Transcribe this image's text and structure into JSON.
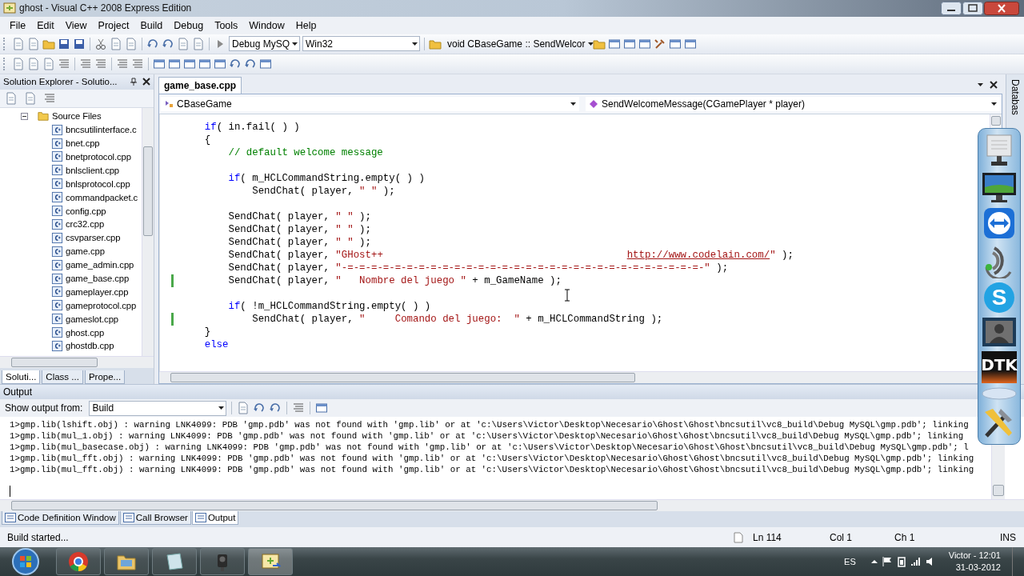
{
  "window": {
    "title": "ghost - Visual C++ 2008 Express Edition"
  },
  "menu": [
    "File",
    "Edit",
    "View",
    "Project",
    "Build",
    "Debug",
    "Tools",
    "Window",
    "Help"
  ],
  "toolbar": {
    "configuration": "Debug MySQ",
    "platform": "Win32",
    "function": "void CBaseGame :: SendWelcor"
  },
  "solution_explorer": {
    "title": "Solution Explorer - Solutio...",
    "tree": [
      {
        "label": "Source Files",
        "expanded": true,
        "children": [
          {
            "label": "bncsutilinterface.c"
          },
          {
            "label": "bnet.cpp"
          },
          {
            "label": "bnetprotocol.cpp"
          },
          {
            "label": "bnlsclient.cpp"
          },
          {
            "label": "bnlsprotocol.cpp"
          },
          {
            "label": "commandpacket.c"
          },
          {
            "label": "config.cpp"
          },
          {
            "label": "crc32.cpp"
          },
          {
            "label": "csvparser.cpp"
          },
          {
            "label": "game.cpp"
          },
          {
            "label": "game_admin.cpp"
          },
          {
            "label": "game_base.cpp"
          },
          {
            "label": "gameplayer.cpp"
          },
          {
            "label": "gameprotocol.cpp"
          },
          {
            "label": "gameslot.cpp"
          },
          {
            "label": "ghost.cpp"
          },
          {
            "label": "ghostdb.cpp"
          }
        ]
      }
    ],
    "tabs": [
      {
        "label": "Soluti...",
        "selected": true
      },
      {
        "label": "Class ...",
        "selected": false
      },
      {
        "label": "Prope...",
        "selected": false
      }
    ]
  },
  "editor": {
    "tabs": [
      {
        "label": "game_base.cpp",
        "selected": true
      }
    ],
    "class_dropdown": "CBaseGame",
    "member_dropdown": "SendWelcomeMessage(CGamePlayer * player)",
    "lines": [
      {
        "changed": false,
        "segments": [
          {
            "kind": "keyword",
            "text": "    if"
          },
          {
            "kind": "plain",
            "text": "( in.fail( ) )"
          }
        ]
      },
      {
        "changed": false,
        "segments": [
          {
            "kind": "plain",
            "text": "    {"
          }
        ]
      },
      {
        "changed": false,
        "segments": [
          {
            "kind": "comment",
            "text": "        // default welcome message"
          }
        ]
      },
      {
        "changed": false
      },
      {
        "changed": false,
        "segments": [
          {
            "kind": "keyword",
            "text": "        if"
          },
          {
            "kind": "plain",
            "text": "( m_HCLCommandString.empty( ) )"
          }
        ]
      },
      {
        "changed": false,
        "segments": [
          {
            "kind": "plain",
            "text": "            SendChat( player, "
          },
          {
            "kind": "string",
            "text": "\" \""
          },
          {
            "kind": "plain",
            "text": " );"
          }
        ]
      },
      {
        "changed": false
      },
      {
        "changed": false,
        "segments": [
          {
            "kind": "plain",
            "text": "        SendChat( player, "
          },
          {
            "kind": "string",
            "text": "\" \""
          },
          {
            "kind": "plain",
            "text": " );"
          }
        ]
      },
      {
        "changed": false,
        "segments": [
          {
            "kind": "plain",
            "text": "        SendChat( player, "
          },
          {
            "kind": "string",
            "text": "\" \""
          },
          {
            "kind": "plain",
            "text": " );"
          }
        ]
      },
      {
        "changed": false,
        "segments": [
          {
            "kind": "plain",
            "text": "        SendChat( player, "
          },
          {
            "kind": "string",
            "text": "\" \""
          },
          {
            "kind": "plain",
            "text": " );"
          }
        ]
      },
      {
        "changed": false,
        "segments": [
          {
            "kind": "plain",
            "text": "        SendChat( player, "
          },
          {
            "kind": "string",
            "text": "\"GHost++                                         "
          },
          {
            "kind": "link",
            "text": "http://www.codelain.com/"
          },
          {
            "kind": "string",
            "text": "\""
          },
          {
            "kind": "plain",
            "text": " );"
          }
        ]
      },
      {
        "changed": false,
        "segments": [
          {
            "kind": "plain",
            "text": "        SendChat( player, "
          },
          {
            "kind": "string",
            "text": "\"-=-=-=-=-=-=-=-=-=-=-=-=-=-=-=-=-=-=-=-=-=-=-=-=-=-=-=-=-=-=-\""
          },
          {
            "kind": "plain",
            "text": " );"
          }
        ]
      },
      {
        "changed": true,
        "segments": [
          {
            "kind": "plain",
            "text": "        SendChat( player, "
          },
          {
            "kind": "string",
            "text": "\"   Nombre del juego \""
          },
          {
            "kind": "plain",
            "text": " + m_GameName );"
          }
        ]
      },
      {
        "changed": false
      },
      {
        "changed": false,
        "segments": [
          {
            "kind": "keyword",
            "text": "        if"
          },
          {
            "kind": "plain",
            "text": "( !m_HCLCommandString.empty( ) )"
          }
        ]
      },
      {
        "changed": true,
        "segments": [
          {
            "kind": "plain",
            "text": "            SendChat( player, "
          },
          {
            "kind": "string",
            "text": "\"     Comando del juego:  \""
          },
          {
            "kind": "plain",
            "text": " + m_HCLCommandString );"
          }
        ]
      },
      {
        "changed": false,
        "segments": [
          {
            "kind": "plain",
            "text": "    }"
          }
        ]
      },
      {
        "changed": false,
        "segments": [
          {
            "kind": "keyword",
            "text": "    else"
          }
        ]
      }
    ]
  },
  "side_tab": "Databas",
  "output": {
    "title": "Output",
    "source_label": "Show output from:",
    "source": "Build",
    "lines": [
      "1>gmp.lib(lshift.obj) : warning LNK4099: PDB 'gmp.pdb' was not found with 'gmp.lib' or at 'c:\\Users\\Victor\\Desktop\\Necesario\\Ghost\\Ghost\\bncsutil\\vc8_build\\Debug MySQL\\gmp.pdb'; linking",
      "1>gmp.lib(mul_1.obj) : warning LNK4099: PDB 'gmp.pdb' was not found with 'gmp.lib' or at 'c:\\Users\\Victor\\Desktop\\Necesario\\Ghost\\Ghost\\bncsutil\\vc8_build\\Debug MySQL\\gmp.pdb'; linking",
      "1>gmp.lib(mul_basecase.obj) : warning LNK4099: PDB 'gmp.pdb' was not found with 'gmp.lib' or at 'c:\\Users\\Victor\\Desktop\\Necesario\\Ghost\\Ghost\\bncsutil\\vc8_build\\Debug MySQL\\gmp.pdb'; l",
      "1>gmp.lib(mul_fft.obj) : warning LNK4099: PDB 'gmp.pdb' was not found with 'gmp.lib' or at 'c:\\Users\\Victor\\Desktop\\Necesario\\Ghost\\Ghost\\bncsutil\\vc8_build\\Debug MySQL\\gmp.pdb'; linking",
      "1>gmp.lib(mul_fft.obj) : warning LNK4099: PDB 'gmp.pdb' was not found with 'gmp.lib' or at 'c:\\Users\\Victor\\Desktop\\Necesario\\Ghost\\Ghost\\bncsutil\\vc8_build\\Debug MySQL\\gmp.pdb'; linking"
    ]
  },
  "bottom_tabs": [
    {
      "label": "Code Definition Window",
      "selected": false
    },
    {
      "label": "Call Browser",
      "selected": false
    },
    {
      "label": "Output",
      "selected": true
    }
  ],
  "status_bar": {
    "message": "Build started...",
    "line": "Ln 114",
    "column": "Col 1",
    "char": "Ch 1",
    "mode": "INS"
  },
  "dock": [
    {
      "kind": "monitor"
    },
    {
      "kind": "display"
    },
    {
      "kind": "arrows"
    },
    {
      "kind": "speaker"
    },
    {
      "kind": "letter",
      "label": "S"
    },
    {
      "kind": "person"
    },
    {
      "kind": "letters",
      "label": "DTK"
    },
    {
      "kind": "oval"
    },
    {
      "kind": "tools"
    }
  ],
  "taskbar": {
    "language": "ES",
    "user_time": "Victor - 12:01",
    "date": "31-03-2012"
  }
}
